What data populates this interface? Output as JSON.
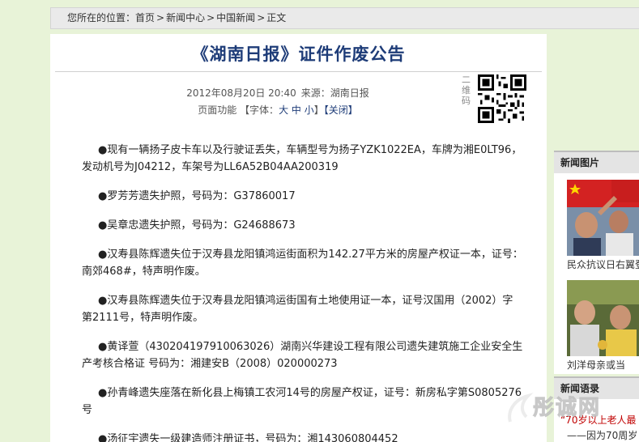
{
  "breadcrumb": {
    "prefix": "您所在的位置：",
    "items": [
      "首页",
      "新闻中心",
      "中国新闻",
      "正文"
    ],
    "separator": ">"
  },
  "article": {
    "title": "《湖南日报》证件作废公告",
    "datetime": "2012年08月20日 20:40",
    "source": "来源：湖南日报",
    "functions_label": "页面功能",
    "font_label": "【字体：",
    "font_sizes": [
      "大",
      "中",
      "小"
    ],
    "font_end": "】",
    "close_label": "【关闭】",
    "qr_label": "二维码",
    "items": [
      "●现有一辆扬子皮卡车以及行驶证丢失，车辆型号为扬子YZK1022EA，车牌为湘E0LT96，发动机号为J04212，车架号为LL6A52B04AA200319",
      "●罗芳芳遗失护照，号码为：G37860017",
      "●吴章忠遗失护照，号码为：G24688673",
      "●汉寿县陈辉遗失位于汉寿县龙阳镇鸿运街面积为142.27平方米的房屋产权证一本，证号：南郊468#，特声明作废。",
      "●汉寿县陈辉遗失位于汉寿县龙阳镇鸿运街国有土地使用证一本，证号汉国用（2002）字第2111号，特声明作废。",
      "●黄译萱（430204197910063026）湖南兴华建设工程有限公司遗失建筑施工企业安全生产考核合格证 号码为：湘建安B（2008）020000273",
      "●孙青峰遗失座落在新化县上梅镇工农河14号的房屋产权证，证号：新房私字第S0805276号",
      "●汤征宇遗失一级建造师注册证书，号码为：湘143060804452"
    ]
  },
  "sidebar": {
    "news_photos_title": "新闻图片",
    "photo1_caption": "民众抗议日右翼登",
    "photo2_caption": "刘洋母亲或当",
    "news_quotes_title": "新闻语录",
    "quote1": "“70岁以上老人最",
    "quote2": "——因为70周岁"
  },
  "watermark": {
    "text": "彤诚网"
  }
}
